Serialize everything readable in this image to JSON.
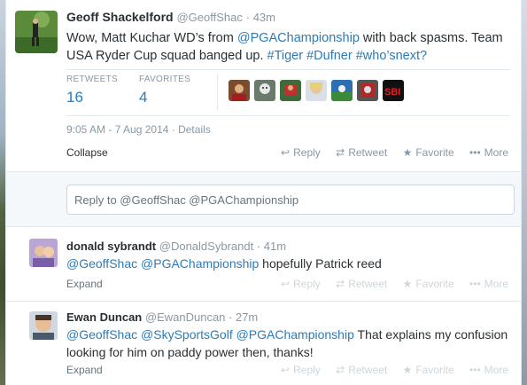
{
  "main_tweet": {
    "fullname": "Geoff Shackelford",
    "username": "@GeoffShac",
    "time": "· 43m",
    "text_parts": [
      {
        "t": "Wow, Matt Kuchar WD’s from ",
        "k": "text"
      },
      {
        "t": "@PGAChampionship",
        "k": "link"
      },
      {
        "t": " with back spasms. Team USA Ryder Cup squad banged up. ",
        "k": "text"
      },
      {
        "t": "#Tiger",
        "k": "link"
      },
      {
        "t": " ",
        "k": "text"
      },
      {
        "t": "#Dufner",
        "k": "link"
      },
      {
        "t": " ",
        "k": "text"
      },
      {
        "t": "#who’snext?",
        "k": "link"
      }
    ],
    "retweets_label": "RETWEETS",
    "retweets_count": "16",
    "favorites_label": "FAVORITES",
    "favorites_count": "4",
    "timestamp": "9:05 AM - 7 Aug 2014",
    "details_label": "· Details",
    "collapse_label": "Collapse",
    "actions": {
      "reply": "Reply",
      "retweet": "Retweet",
      "favorite": "Favorite",
      "more": "More"
    }
  },
  "reply_box": {
    "placeholder": "Reply to @GeoffShac @PGAChampionship"
  },
  "replies": [
    {
      "fullname": "donald sybrandt",
      "username": "@DonaldSybrandt",
      "time": "· 41m",
      "line1": [
        {
          "t": "@GeoffShac",
          "k": "link"
        },
        {
          "t": " ",
          "k": "text"
        },
        {
          "t": "@PGAChampionship",
          "k": "link"
        },
        {
          "t": " hopefully Patrick reed",
          "k": "text"
        }
      ],
      "expand": "Expand"
    },
    {
      "fullname": "Ewan Duncan",
      "username": "@EwanDuncan",
      "time": "· 27m",
      "line1": [
        {
          "t": "@GeoffShac",
          "k": "link"
        },
        {
          "t": " ",
          "k": "text"
        },
        {
          "t": "@SkySportsGolf",
          "k": "link"
        },
        {
          "t": " ",
          "k": "text"
        },
        {
          "t": "@PGAChampionship",
          "k": "link"
        },
        {
          "t": " That explains my confusion looking for him on paddy power then, thanks!",
          "k": "text"
        }
      ],
      "expand": "Expand"
    }
  ],
  "colors": {
    "link": "#2b7bb9",
    "muted": "#8899a6",
    "text": "#292f33"
  },
  "icons": [
    "reply-icon",
    "retweet-icon",
    "favorite-icon",
    "more-icon"
  ]
}
